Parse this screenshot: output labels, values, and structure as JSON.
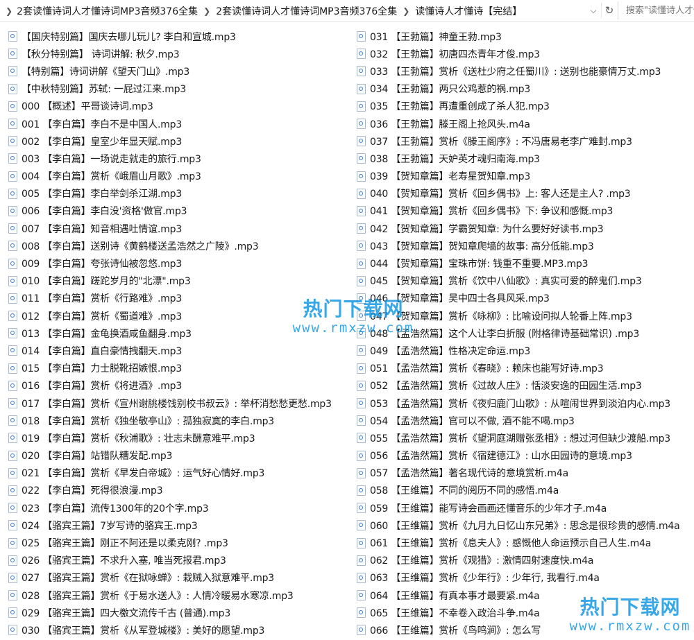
{
  "breadcrumb": {
    "items": [
      "2套读懂诗词人才懂诗词MP3音频376全集",
      "2套读懂诗词人才懂诗词MP3音频376全集",
      "读懂诗人才懂诗【完结】"
    ]
  },
  "search": {
    "placeholder": "搜索\"读懂诗人才懂诗【完结】\""
  },
  "files_left": [
    "【国庆特别篇】国庆去哪儿玩儿? 李白和宣城.mp3",
    "【秋分特别篇】 诗词讲解: 秋夕.mp3",
    "【特别篇】诗词讲解《望天门山》.mp3",
    "【中秋特别篇】苏轼: 一屁过江来.mp3",
    "000 【概述】平哥谈诗词.mp3",
    "001 【李白篇】李白不是中国人.mp3",
    "002 【李白篇】皇室少年显天赋.mp3",
    "003 【李白篇】一场说走就走的旅行.mp3",
    "004 【李白篇】赏析《峨眉山月歌》.mp3",
    "005 【李白篇】李白举剑杀江湖.mp3",
    "006 【李白篇】李白没'资格'做官.mp3",
    "007 【李白篇】知音相遇吐情谊.mp3",
    "008 【李白篇】送别诗《黄鹤楼送孟浩然之广陵》.mp3",
    "009 【李白篇】夸张诗仙被忽悠.mp3",
    "010 【李白篇】蹉跎岁月的\"北漂\".mp3",
    "011 【李白篇】赏析《行路难》.mp3",
    "012 【李白篇】赏析《蜀道难》.mp3",
    "013 【李白篇】金龟换酒咸鱼翻身.mp3",
    "014 【李白篇】直白豪情拽翻天.mp3",
    "015 【李白篇】力士脱靴招嫉恨.mp3",
    "016 【李白篇】赏析《将进酒》.mp3",
    "017 【李白篇】赏析《宣州谢朓楼饯别校书叔云》: 举杯消愁愁更愁.mp3",
    "018 【李白篇】赏析《独坐敬亭山》: 孤独寂寞的李白.mp3",
    "019 【李白篇】赏析《秋浦歌》: 壮志未酬意难平.mp3",
    "020 【李白篇】站错队糟发配.mp3",
    "021 【李白篇】赏析《早发白帝城》: 运气好心情好.mp3",
    "022 【李白篇】死得很浪漫.mp3",
    "023 【李白篇】流传1300年的20个字.mp3",
    "024 【骆宾王篇】7岁写诗的骆宾王.mp3",
    "025 【骆宾王篇】刚正不阿还是以柔克刚? .mp3",
    "026 【骆宾王篇】不求升入塞, 唯当死报君.mp3",
    "027 【骆宾王篇】赏析《在狱咏蝉》: 栽贼入狱意难平.mp3",
    "028 【骆宾王篇】赏析《于易水送人》: 人情冷暖易水寒凉.mp3",
    "029 【骆宾王篇】四大檄文流传千古 (普通).mp3",
    "030 【骆宾王篇】赏析《从军登城楼》: 美好的愿望.mp3"
  ],
  "files_right": [
    "031 【王勃篇】神童王勃.mp3",
    "032 【王勃篇】初唐四杰青年才俊.mp3",
    "033 【王勃篇】赏析《送杜少府之任蜀川》: 送别也能豪情万丈.mp3",
    "034 【王勃篇】两只公鸡惹的祸.mp3",
    "035 【王勃篇】再遭重创成了杀人犯.mp3",
    "036 【王勃篇】滕王阁上抢风头.m4a",
    "037 【王勃篇】赏析《滕王阁序》: 不冯唐易老李广难封.mp3",
    "038 【王勃篇】天妒英才魂归南海.mp3",
    "039 【贺知章篇】老寿星贺知章.mp3",
    "040 【贺知章篇】赏析《回乡偶书》上: 客人还是主人? .mp3",
    "041 【贺知章篇】赏析《回乡偶书》下: 争议和感慨.mp3",
    "042 【贺知章篇】学霸贺知章: 为什么要好好读书.mp3",
    "043 【贺知章篇】贺知章爬墙的故事: 高分低能.mp3",
    "044 【贺知章篇】宝珠市饼: 钱重不重要.MP3.mp3",
    "045 【贺知章篇】赏析《饮中八仙歌》: 真实可爱的醉鬼们.mp3",
    "046 【贺知章篇】吴中四士各具风采.mp3",
    "047 【贺知章篇】赏析《咏柳》: 比喻设问拟人轮番上阵.mp3",
    "048 【孟浩然篇】这个人让李白折服 (附格律诗基础常识) .mp3",
    "049 【孟浩然篇】性格决定命运.mp3",
    "051 【孟浩然篇】赏析《春晓》: 赖床也能写好诗.mp3",
    "052 【孟浩然篇】赏析《过故人庄》: 恬淡安逸的田园生活.mp3",
    "053 【孟浩然篇】赏析《夜归鹿门山歌》: 从喧闹世界到淡泊内心.mp3",
    "054 【孟浩然篇】官可以不做, 酒不能不喝.mp3",
    "055 【孟浩然篇】赏析《望洞庭湖赠张丞相》: 想过河但缺少渡船.mp3",
    "056 【孟浩然篇】赏析《宿建德江》: 山水田园诗的意境.mp3",
    "057 【孟浩然篇】著名现代诗的意境赏析.m4a",
    "058 【王维篇】不同的阅历不同的感悟.m4a",
    "059 【王维篇】能写诗会画画还懂音乐的少年才子.m4a",
    "060 【王维篇】赏析《九月九日忆山东兄弟》: 思念是很珍贵的感情.m4a",
    "061 【王维篇】赏析《息夫人》: 感慨他人命运预示自己人生.m4a",
    "062 【王维篇】赏析《观猎》: 激情四射速度快.m4a",
    "063 【王维篇】赏析《少年行》: 少年行, 我看行.m4a",
    "064 【王维篇】有真本事才最要紧.m4a",
    "065 【王维篇】不幸卷入政治斗争.m4a",
    "066 【王维篇】赏析《鸟鸣涧》: 怎么写"
  ],
  "watermarks": [
    {
      "title": "热门下载网",
      "url": "www.rmxzw.com"
    },
    {
      "title": "热门下载网",
      "url": "www.rmxzw.com"
    }
  ]
}
